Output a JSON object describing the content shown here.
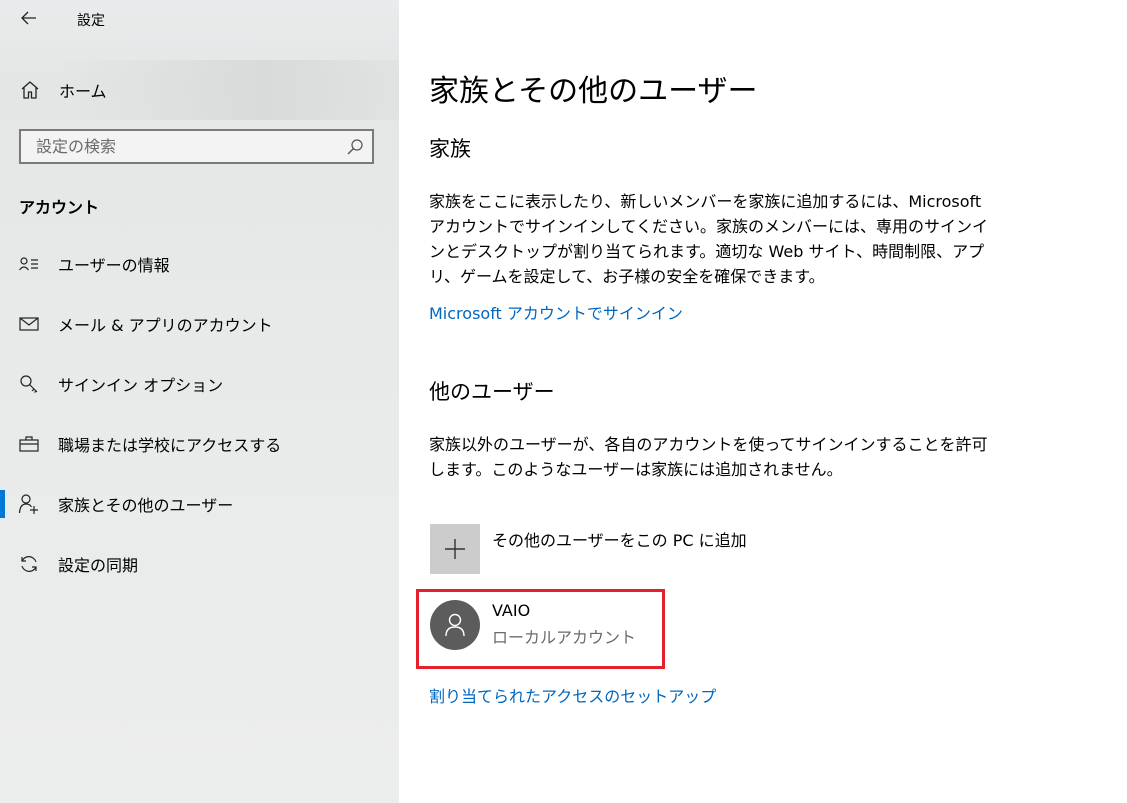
{
  "window": {
    "title": "設定"
  },
  "sidebar": {
    "home_label": "ホーム",
    "search_placeholder": "設定の検索",
    "section_header": "アカウント",
    "items": [
      {
        "label": "ユーザーの情報",
        "icon": "user-info-icon",
        "selected": false
      },
      {
        "label": "メール & アプリのアカウント",
        "icon": "mail-icon",
        "selected": false
      },
      {
        "label": "サインイン オプション",
        "icon": "key-icon",
        "selected": false
      },
      {
        "label": "職場または学校にアクセスする",
        "icon": "briefcase-icon",
        "selected": false
      },
      {
        "label": "家族とその他のユーザー",
        "icon": "family-user-icon",
        "selected": true
      },
      {
        "label": "設定の同期",
        "icon": "sync-icon",
        "selected": false
      }
    ]
  },
  "main": {
    "title": "家族とその他のユーザー",
    "family": {
      "heading": "家族",
      "description": "家族をここに表示したり、新しいメンバーを家族に追加するには、Microsoft アカウントでサインインしてください。家族のメンバーには、専用のサインインとデスクトップが割り当てられます。適切な Web サイト、時間制限、アプリ、ゲームを設定して、お子様の安全を確保できます。",
      "link": "Microsoft アカウントでサインイン"
    },
    "other_users": {
      "heading": "他のユーザー",
      "description": "家族以外のユーザーが、各自のアカウントを使ってサインインすることを許可します。このようなユーザーは家族には追加されません。",
      "add_label": "その他のユーザーをこの PC に追加",
      "users": [
        {
          "name": "VAIO",
          "type": "ローカルアカウント"
        }
      ],
      "assigned_access_link": "割り当てられたアクセスのセットアップ"
    }
  },
  "colors": {
    "accent": "#0078d7",
    "link": "#0067c0",
    "highlight": "#e3202b",
    "sidebar_bg": "#e8eaea"
  }
}
